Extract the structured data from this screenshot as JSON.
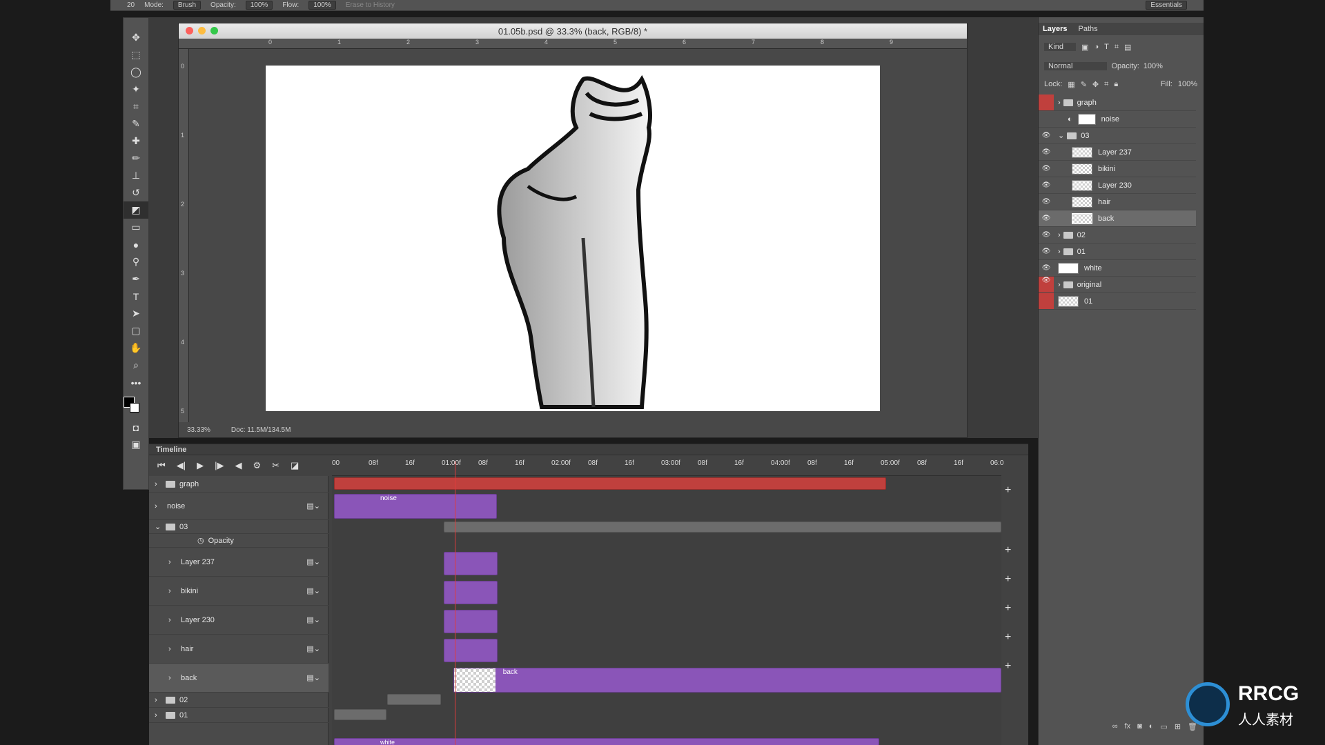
{
  "options_bar": {
    "mode_label": "Mode:",
    "mode_value": "Brush",
    "opacity_label": "Opacity:",
    "opacity_value": "100%",
    "flow_label": "Flow:",
    "flow_value": "100%",
    "brush_size": "20",
    "erase_history": "Erase to History",
    "workspace": "Essentials"
  },
  "document": {
    "title": "01.05b.psd @ 33.3% (back, RGB/8) *",
    "zoom": "33.33%",
    "doc_size": "Doc: 11.5M/134.5M",
    "ruler_top": [
      "0",
      "1",
      "2",
      "3",
      "4",
      "5",
      "6",
      "7",
      "8",
      "9"
    ],
    "ruler_left": [
      "0",
      "1",
      "2",
      "3",
      "4",
      "5"
    ]
  },
  "timeline": {
    "title": "Timeline",
    "ticks": [
      "00",
      "08f",
      "16f",
      "01:00f",
      "08f",
      "16f",
      "02:00f",
      "08f",
      "16f",
      "03:00f",
      "08f",
      "16f",
      "04:00f",
      "08f",
      "16f",
      "05:00f",
      "08f",
      "16f",
      "06:0"
    ],
    "rows": [
      {
        "label": "graph"
      },
      {
        "label": "noise"
      },
      {
        "label": "03"
      },
      {
        "label": "Opacity"
      },
      {
        "label": "Layer 237"
      },
      {
        "label": "bikini"
      },
      {
        "label": "Layer 230"
      },
      {
        "label": "hair"
      },
      {
        "label": "back"
      },
      {
        "label": "02"
      },
      {
        "label": "01"
      }
    ],
    "clip_labels": {
      "noise": "noise",
      "back": "back",
      "white": "white"
    }
  },
  "layers_panel": {
    "tab_layers": "Layers",
    "tab_paths": "Paths",
    "filter_kind": "Kind",
    "blend_mode": "Normal",
    "opacity_label": "Opacity:",
    "opacity_value": "100%",
    "lock_label": "Lock:",
    "fill_label": "Fill:",
    "fill_value": "100%",
    "layers": [
      {
        "name": "graph"
      },
      {
        "name": "noise"
      },
      {
        "name": "03"
      },
      {
        "name": "Layer 237"
      },
      {
        "name": "bikini"
      },
      {
        "name": "Layer 230"
      },
      {
        "name": "hair"
      },
      {
        "name": "back"
      },
      {
        "name": "02"
      },
      {
        "name": "01"
      },
      {
        "name": "white"
      },
      {
        "name": "original"
      },
      {
        "name": "01"
      }
    ]
  },
  "logo": {
    "top": "RRCG",
    "bottom": "人人素材"
  },
  "colors": {
    "accent_purple": "#8a55b8",
    "playhead_red": "#e03c3c",
    "group_red": "#c0403d"
  }
}
